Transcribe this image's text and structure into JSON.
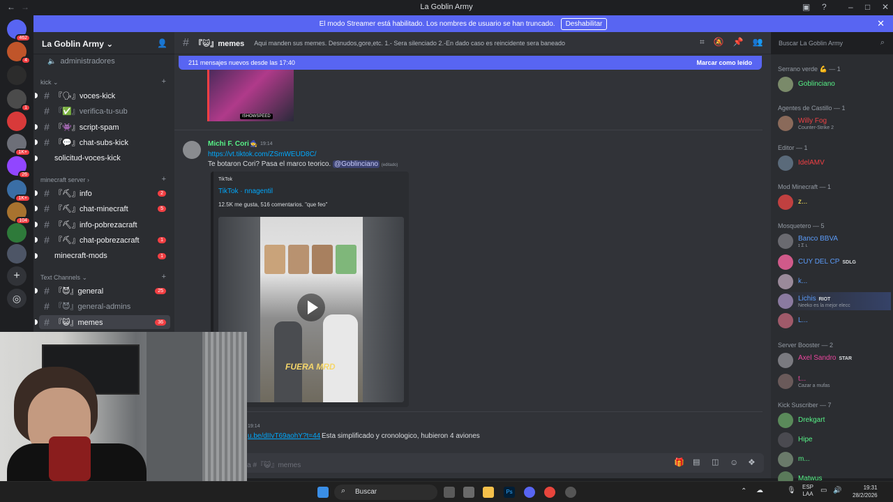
{
  "window": {
    "title": "La Goblin Army"
  },
  "streamer_banner": {
    "text": "El modo Streamer está habilitado. Los nombres de usuario se han truncado.",
    "button": "Deshabilitar"
  },
  "servers": [
    {
      "badge": "462"
    },
    {
      "badge": "4"
    },
    {
      "badge": ""
    },
    {
      "badge": "1"
    },
    {
      "badge": ""
    },
    {
      "badge": "1K+"
    },
    {
      "badge": "26"
    },
    {
      "badge": "1K+"
    },
    {
      "badge": "104"
    },
    {
      "badge": ""
    },
    {
      "badge": ""
    }
  ],
  "guild": {
    "name": "La Goblin Army"
  },
  "channels": {
    "top": {
      "name": "administradores"
    },
    "kick": {
      "label": "kick",
      "items": [
        {
          "name": "『🗣』voces-kick",
          "state": "unread"
        },
        {
          "name": "『✅』verifica-tu-sub",
          "state": "muted"
        },
        {
          "name": "『👾』script-spam",
          "state": "unread"
        },
        {
          "name": "『💬』chat-subs-kick",
          "state": "unread"
        },
        {
          "name": "solicitud-voces-kick",
          "state": "unread"
        }
      ]
    },
    "minecraft": {
      "label": "minecraft server",
      "items": [
        {
          "name": "『⛏』info",
          "count": "2"
        },
        {
          "name": "『⛏』chat-minecraft",
          "count": "5"
        },
        {
          "name": "『⛏』info-pobrezacraft",
          "count": ""
        },
        {
          "name": "『⛏』chat-pobrezacraft",
          "count": "1"
        },
        {
          "name": "minecraft-mods",
          "count": "1"
        }
      ]
    },
    "text": {
      "label": "Text Channels",
      "items": [
        {
          "name": "『😈』general",
          "count": "25"
        },
        {
          "name": "『😈』general-admins",
          "count": ""
        },
        {
          "name": "『😺』memes",
          "count": "36"
        }
      ]
    }
  },
  "header": {
    "channel": "『😺』memes",
    "topic": "Aqui manden sus memes. Desnudos,gore,etc. 1.- Sera silenciado 2.-En dado caso es reincidente sera baneado",
    "search_placeholder": "Buscar La Goblin Army"
  },
  "newbar": {
    "text": "211 mensajes nuevos desde las 17:40",
    "mark": "Marcar como leído"
  },
  "message1": {
    "author": "Michi F. Cori",
    "time": "19:14",
    "link": "https://vt.tiktok.com/ZSmWEUD8C/",
    "text": "Te botaron Cori? Pasa el marco teorico.",
    "mention": "@Goblinciano",
    "edited": "(editado)",
    "embed": {
      "provider": "TikTok",
      "title": "TikTok · nnagentil",
      "desc": "12.5K me gusta, 516 comentarios. \"que feo\"",
      "video_caption": "FUERA MRD"
    }
  },
  "prev_image_label": "ISHOWSPEED",
  "message2": {
    "time": "19:14",
    "link": "u.be/dIIvT69aohY?t=44",
    "text": "Esta simplificado y cronologico, hubieron 4 aviones"
  },
  "composer": {
    "placeholder": "aje a #『😺』memes"
  },
  "members": {
    "groups": [
      {
        "role": "Serrano verde 💪 — 1",
        "members": [
          {
            "name": "Goblinciano",
            "color": "#57f287",
            "sub": ""
          }
        ]
      },
      {
        "role": "Agentes de Castillo — 1",
        "members": [
          {
            "name": "Willy Fog",
            "color": "#ed4245",
            "sub": "Counter-Strike 2"
          }
        ]
      },
      {
        "role": "Editor — 1",
        "members": [
          {
            "name": "IdelAMV",
            "color": "#f23f43",
            "sub": ""
          }
        ]
      },
      {
        "role": "Mod Minecraft — 1",
        "members": [
          {
            "name": "z...",
            "color": "#fee75c",
            "sub": ""
          }
        ]
      },
      {
        "role": "Mosquetero — 5",
        "members": [
          {
            "name": "Banco BBVA",
            "color": "#5b9bf8",
            "sub": "ɪ Σ ʟ",
            "tag": ""
          },
          {
            "name": "CUY DEL CP",
            "color": "#5b9bf8",
            "sub": "",
            "tag": "SDLG"
          },
          {
            "name": "k...",
            "color": "#5b9bf8",
            "sub": "",
            "tag": ""
          },
          {
            "name": "Lichis",
            "color": "#5b9bf8",
            "sub": "Neeko es la mejor elecc",
            "tag": "RIOT"
          },
          {
            "name": "L...",
            "color": "#5b9bf8",
            "sub": "",
            "tag": ""
          }
        ]
      },
      {
        "role": "Server Booster — 2",
        "members": [
          {
            "name": "Axel Sandro",
            "color": "#eb459e",
            "sub": "",
            "tag": "STAR"
          },
          {
            "name": "t...",
            "color": "#eb459e",
            "sub": "Cazar a mufas",
            "tag": ""
          }
        ]
      },
      {
        "role": "Kick Suscriber — 7",
        "members": [
          {
            "name": "Drekgart",
            "color": "#57f287",
            "sub": ""
          },
          {
            "name": "Hipe",
            "color": "#57f287",
            "sub": ""
          },
          {
            "name": "m...",
            "color": "#57f287",
            "sub": ""
          },
          {
            "name": "Matwus",
            "color": "#57f287",
            "sub": ""
          }
        ]
      }
    ]
  },
  "taskbar": {
    "search": "Buscar",
    "lang1": "ESP",
    "lang2": "LAA",
    "time": "19:31",
    "date": "28/2/2026"
  },
  "colors": {
    "blurple": "#5865f2",
    "link": "#00a8fc",
    "mention_bg": "#3c4270"
  }
}
